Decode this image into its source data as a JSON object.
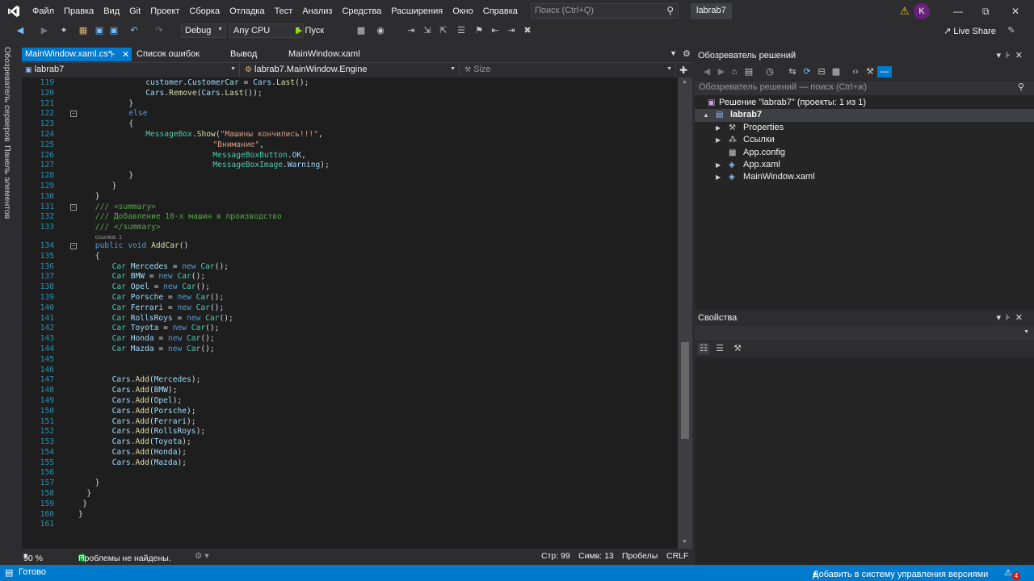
{
  "menubar": {
    "items": [
      "Файл",
      "Правка",
      "Вид",
      "Git",
      "Проект",
      "Сборка",
      "Отладка",
      "Тест",
      "Анализ",
      "Средства",
      "Расширения",
      "Окно",
      "Справка"
    ],
    "search_placeholder": "Поиск (Ctrl+Q)",
    "solution_name": "labrab7",
    "avatar_initial": "K"
  },
  "toolbar": {
    "configuration": "Debug",
    "platform": "Any CPU",
    "run_label": "Пуск",
    "live_share": "Live Share"
  },
  "side_tabs": [
    "Обозреватель серверов",
    "Панель элементов"
  ],
  "doc_tabs": {
    "active": "MainWindow.xaml.cs*",
    "tab2": "Список ошибок",
    "tab3": "Вывод",
    "tab4": "MainWindow.xaml"
  },
  "nav_bar": {
    "project": "labrab7",
    "class": "labrab7.MainWindow.Engine",
    "member": "Size"
  },
  "code": [
    {
      "n": "119",
      "h": "<span class='p'>customer</span>.<span class='p'>CustomerCar</span> = <span class='p'>Cars</span>.<span class='m'>Last</span>();",
      "i": 16
    },
    {
      "n": "120",
      "h": "<span class='p'>Cars</span>.<span class='m'>Remove</span>(<span class='p'>Cars</span>.<span class='m'>Last</span>());",
      "i": 16
    },
    {
      "n": "121",
      "h": "}",
      "i": 12
    },
    {
      "n": "122",
      "h": "<span class='k'>else</span>",
      "i": 12,
      "fold": true
    },
    {
      "n": "123",
      "h": "{",
      "i": 12
    },
    {
      "n": "124",
      "h": "<span class='t'>MessageBox</span>.<span class='m'>Show</span>(<span class='s'>\"Машины кончились!!!\"</span>,",
      "i": 16
    },
    {
      "n": "125",
      "h": "<span class='s'>\"Внимание\"</span>,",
      "i": 32
    },
    {
      "n": "126",
      "h": "<span class='t'>MessageBoxButton</span>.<span class='p'>OK</span>,",
      "i": 32
    },
    {
      "n": "127",
      "h": "<span class='t'>MessageBoxImage</span>.<span class='p'>Warning</span>);",
      "i": 32
    },
    {
      "n": "128",
      "h": "}",
      "i": 12
    },
    {
      "n": "129",
      "h": "}",
      "i": 8
    },
    {
      "n": "130",
      "h": "}",
      "i": 4
    },
    {
      "n": "131",
      "h": "<span class='c'>/// &lt;summary&gt;</span>",
      "i": 4,
      "fold": true
    },
    {
      "n": "132",
      "h": "<span class='c'>/// Добавление 10-х машин в производство</span>",
      "i": 4
    },
    {
      "n": "133",
      "h": "<span class='c'>/// &lt;/summary&gt;</span>",
      "i": 4
    },
    {
      "lens": "ссылка: 1",
      "i": 4
    },
    {
      "n": "134",
      "h": "<span class='k'>public</span> <span class='k'>void</span> <span class='m'>AddCar</span>()",
      "i": 4,
      "fold": true
    },
    {
      "n": "135",
      "h": "{",
      "i": 4
    },
    {
      "n": "136",
      "h": "<span class='t'>Car</span> <span class='p'>Mercedes</span> = <span class='k'>new</span> <span class='t'>Car</span>();",
      "i": 8
    },
    {
      "n": "137",
      "h": "<span class='t'>Car</span> <span class='p'>BMW</span> = <span class='k'>new</span> <span class='t'>Car</span>();",
      "i": 8
    },
    {
      "n": "138",
      "h": "<span class='t'>Car</span> <span class='p'>Opel</span> = <span class='k'>new</span> <span class='t'>Car</span>();",
      "i": 8
    },
    {
      "n": "139",
      "h": "<span class='t'>Car</span> <span class='p'>Porsche</span> = <span class='k'>new</span> <span class='t'>Car</span>();",
      "i": 8
    },
    {
      "n": "140",
      "h": "<span class='t'>Car</span> <span class='p'>Ferrari</span> = <span class='k'>new</span> <span class='t'>Car</span>();",
      "i": 8
    },
    {
      "n": "141",
      "h": "<span class='t'>Car</span> <span class='p'>RollsRoys</span> = <span class='k'>new</span> <span class='t'>Car</span>();",
      "i": 8
    },
    {
      "n": "142",
      "h": "<span class='t'>Car</span> <span class='p'>Toyota</span> = <span class='k'>new</span> <span class='t'>Car</span>();",
      "i": 8
    },
    {
      "n": "143",
      "h": "<span class='t'>Car</span> <span class='p'>Honda</span> = <span class='k'>new</span> <span class='t'>Car</span>();",
      "i": 8
    },
    {
      "n": "144",
      "h": "<span class='t'>Car</span> <span class='p'>Mazda</span> = <span class='k'>new</span> <span class='t'>Car</span>();",
      "i": 8
    },
    {
      "n": "145",
      "h": "",
      "i": 8
    },
    {
      "n": "146",
      "h": "",
      "i": 8
    },
    {
      "n": "147",
      "h": "<span class='p'>Cars</span>.<span class='m'>Add</span>(<span class='p'>Mercedes</span>);",
      "i": 8
    },
    {
      "n": "148",
      "h": "<span class='p'>Cars</span>.<span class='m'>Add</span>(<span class='p'>BMW</span>);",
      "i": 8
    },
    {
      "n": "149",
      "h": "<span class='p'>Cars</span>.<span class='m'>Add</span>(<span class='p'>Opel</span>);",
      "i": 8
    },
    {
      "n": "150",
      "h": "<span class='p'>Cars</span>.<span class='m'>Add</span>(<span class='p'>Porsche</span>);",
      "i": 8
    },
    {
      "n": "151",
      "h": "<span class='p'>Cars</span>.<span class='m'>Add</span>(<span class='p'>Ferrari</span>);",
      "i": 8
    },
    {
      "n": "152",
      "h": "<span class='p'>Cars</span>.<span class='m'>Add</span>(<span class='p'>RollsRoys</span>);",
      "i": 8
    },
    {
      "n": "153",
      "h": "<span class='p'>Cars</span>.<span class='m'>Add</span>(<span class='p'>Toyota</span>);",
      "i": 8
    },
    {
      "n": "154",
      "h": "<span class='p'>Cars</span>.<span class='m'>Add</span>(<span class='p'>Honda</span>);",
      "i": 8
    },
    {
      "n": "155",
      "h": "<span class='p'>Cars</span>.<span class='m'>Add</span>(<span class='p'>Mazda</span>);",
      "i": 8
    },
    {
      "n": "156",
      "h": "",
      "i": 8
    },
    {
      "n": "157",
      "h": "}",
      "i": 4
    },
    {
      "n": "158",
      "h": "}",
      "i": 2
    },
    {
      "n": "159",
      "h": "}",
      "i": 1
    },
    {
      "n": "160",
      "h": "}",
      "i": 0
    },
    {
      "n": "161",
      "h": "",
      "i": 0
    }
  ],
  "editor_status": {
    "zoom": "90 %",
    "problems": "Проблемы не найдены.",
    "line": "Стр: 99",
    "col": "Симв: 13",
    "ws": "Пробелы",
    "eol": "CRLF"
  },
  "solution_explorer": {
    "title": "Обозреватель решений",
    "search_placeholder": "Обозреватель решений — поиск (Ctrl+ж)",
    "items": [
      {
        "label": "Решение \"labrab7\" (проекты: 1 из 1)",
        "depth": 0,
        "icon": "solution-icon",
        "exp": ""
      },
      {
        "label": "labrab7",
        "depth": 1,
        "icon": "csharp-project-icon",
        "exp": "▲",
        "bold": true,
        "sel": true
      },
      {
        "label": "Properties",
        "depth": 2,
        "icon": "wrench-icon",
        "exp": "▶"
      },
      {
        "label": "Ссылки",
        "depth": 2,
        "icon": "references-icon",
        "exp": "▶"
      },
      {
        "label": "App.config",
        "depth": 2,
        "icon": "config-file-icon",
        "exp": ""
      },
      {
        "label": "App.xaml",
        "depth": 2,
        "icon": "xaml-file-icon",
        "exp": "▶"
      },
      {
        "label": "MainWindow.xaml",
        "depth": 2,
        "icon": "xaml-file-icon",
        "exp": "▶"
      }
    ]
  },
  "properties": {
    "title": "Свойства"
  },
  "statusbar": {
    "ready": "Готово",
    "source_control": "Добавить в систему управления версиями",
    "notifications": "4"
  }
}
